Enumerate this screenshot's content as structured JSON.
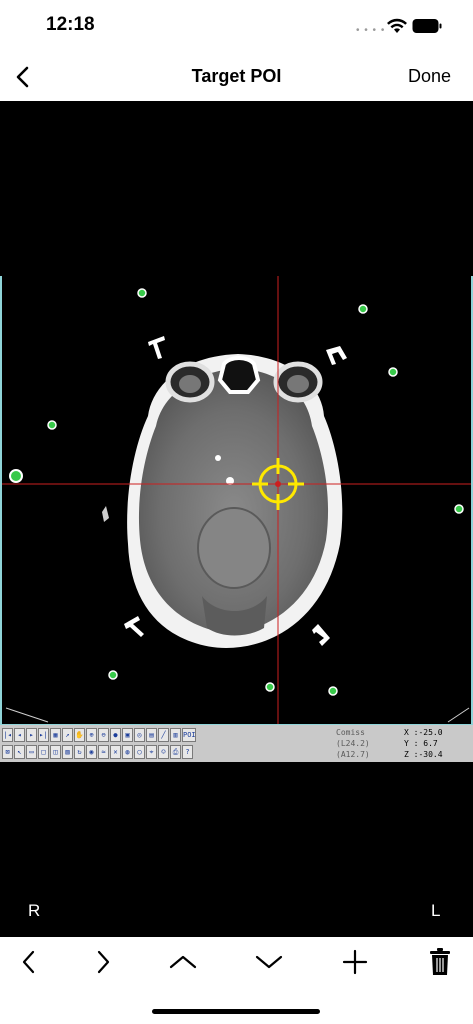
{
  "status_bar": {
    "time": "12:18"
  },
  "nav": {
    "title": "Target POI",
    "done_label": "Done"
  },
  "viewer": {
    "orientation_right": "R",
    "orientation_left": "L",
    "toolbar": {
      "poi_label": "POI",
      "help_label": "?"
    },
    "coordinates": {
      "reference_label": "Comiss",
      "l_label": "(L24.2)",
      "a_label": "(A12.7)",
      "x": "X :-25.0",
      "y": "Y : 6.7",
      "z": "Z :-30.4"
    }
  },
  "icons": {
    "back": "chevron-left-icon",
    "previous": "chevron-left-icon",
    "next": "chevron-right-icon",
    "up": "chevron-up-icon",
    "down": "chevron-down-icon",
    "add": "plus-icon",
    "delete": "trash-icon"
  },
  "colors": {
    "crosshair": "#cc1f1f",
    "target": "#ffe800",
    "fiducial": "#38c94a",
    "frame": "#8fd4d8"
  }
}
